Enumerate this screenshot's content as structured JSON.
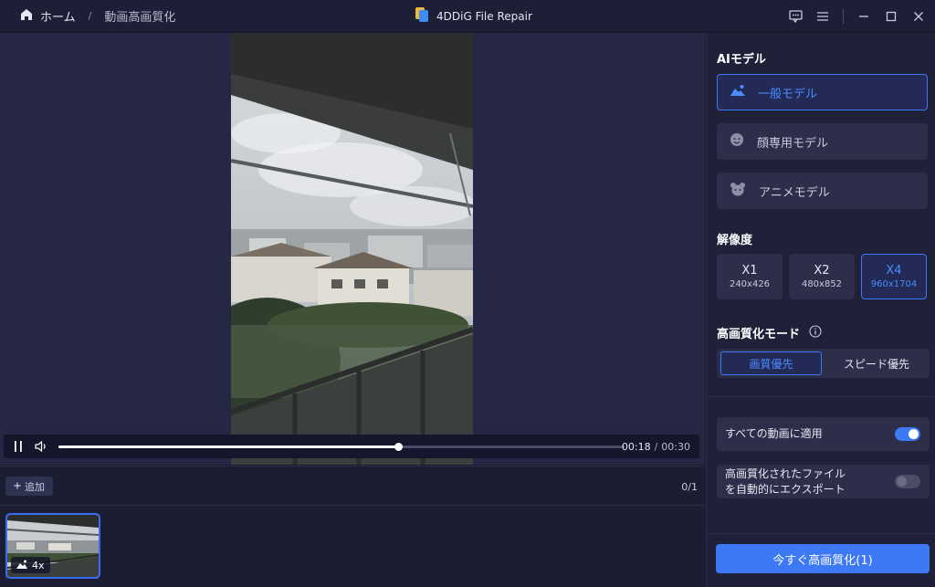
{
  "titlebar": {
    "home_label": "ホーム",
    "separator": "/",
    "breadcrumb": "動画高画質化",
    "app_title": "4DDiG File Repair",
    "icons": [
      "feedback-icon",
      "menu-icon",
      "minimize-icon",
      "maximize-icon",
      "close-icon"
    ]
  },
  "player": {
    "current_time": "00:18",
    "time_separator": "/",
    "total_time": "00:30",
    "progress_fraction": 0.6,
    "playing": true
  },
  "toolbar": {
    "add_label": "追加",
    "counter": "0/1"
  },
  "thumbnail": {
    "badge": "4x"
  },
  "panel": {
    "ai_model_title": "AIモデル",
    "models": [
      {
        "label": "一般モデル",
        "icon": "landscape-icon",
        "active": true
      },
      {
        "label": "顔専用モデル",
        "icon": "face-icon",
        "active": false
      },
      {
        "label": "アニメモデル",
        "icon": "bear-icon",
        "active": false
      }
    ],
    "resolution_title": "解像度",
    "resolutions": [
      {
        "label": "X1",
        "size": "240x426",
        "active": false
      },
      {
        "label": "X2",
        "size": "480x852",
        "active": false
      },
      {
        "label": "X4",
        "size": "960x1704",
        "active": true
      }
    ],
    "mode_title": "高画質化モード",
    "modes": [
      {
        "label": "画質優先",
        "active": true
      },
      {
        "label": "スピード優先",
        "active": false
      }
    ],
    "apply_all_label": "すべての動画に適用",
    "apply_all_on": true,
    "auto_export_label_1": "高画質化されたファイル",
    "auto_export_label_2": "を自動的にエクスポート",
    "auto_export_on": false,
    "cta_label": "今すぐ高画質化(1)"
  },
  "colors": {
    "accent": "#3d78f5",
    "background": "#1b1d33",
    "panel": "#1f2139"
  }
}
